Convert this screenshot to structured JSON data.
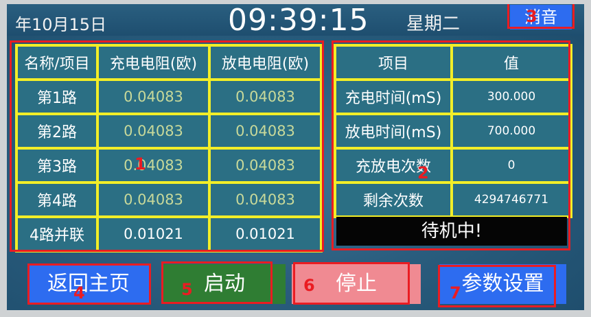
{
  "header": {
    "date": "年10月15日",
    "time": "09:39:15",
    "weekday": "星期二",
    "mute_label": "消音"
  },
  "resistance_table": {
    "headers": [
      "名称/项目",
      "充电电阻(欧)",
      "放电电阻(欧)"
    ],
    "rows": [
      [
        "第1路",
        "0.04083",
        "0.04083"
      ],
      [
        "第2路",
        "0.04083",
        "0.04083"
      ],
      [
        "第3路",
        "0.04083",
        "0.04083"
      ],
      [
        "第4路",
        "0.04083",
        "0.04083"
      ],
      [
        "4路并联",
        "0.01021",
        "0.01021"
      ]
    ]
  },
  "params_table": {
    "headers": [
      "项目",
      "值"
    ],
    "rows": [
      [
        "充电时间(mS)",
        "300.000"
      ],
      [
        "放电时间(mS)",
        "700.000"
      ],
      [
        "充放电次数",
        "0"
      ],
      [
        "剩余次数",
        "4294746771"
      ]
    ]
  },
  "status_text": "待机中!",
  "buttons": {
    "home": "返回主页",
    "start": "启动",
    "stop": "停止",
    "params": "参数设置"
  },
  "annotations": [
    "1",
    "2",
    "3",
    "4",
    "5",
    "6",
    "7"
  ],
  "colors": {
    "grid_line": "#f2ee28",
    "cell_bg": "#2b6f84",
    "button_blue": "#2d6cf0",
    "button_green": "#2f7d33",
    "button_pink": "#f08a92",
    "annotation_red": "#ea1c22"
  }
}
